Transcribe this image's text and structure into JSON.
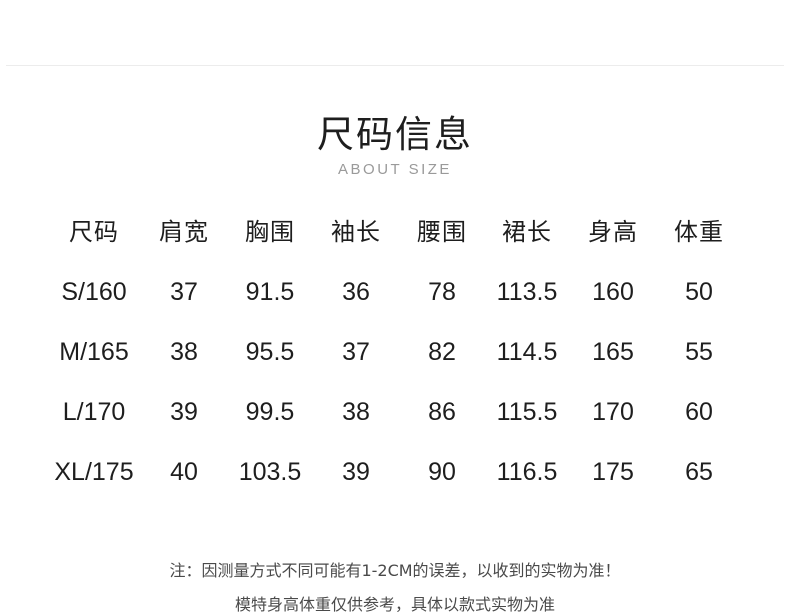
{
  "title": "尺码信息",
  "subtitle": "ABOUT SIZE",
  "table": {
    "headers": [
      "尺码",
      "肩宽",
      "胸围",
      "袖长",
      "腰围",
      "裙长",
      "身高",
      "体重"
    ],
    "rows": [
      [
        "S/160",
        "37",
        "91.5",
        "36",
        "78",
        "113.5",
        "160",
        "50"
      ],
      [
        "M/165",
        "38",
        "95.5",
        "37",
        "82",
        "114.5",
        "165",
        "55"
      ],
      [
        "L/170",
        "39",
        "99.5",
        "38",
        "86",
        "115.5",
        "170",
        "60"
      ],
      [
        "XL/175",
        "40",
        "103.5",
        "39",
        "90",
        "116.5",
        "175",
        "65"
      ]
    ]
  },
  "notes": [
    "注：因测量方式不同可能有1-2CM的误差，以收到的实物为准！",
    "模特身高体重仅供参考，具体以款式实物为准"
  ]
}
